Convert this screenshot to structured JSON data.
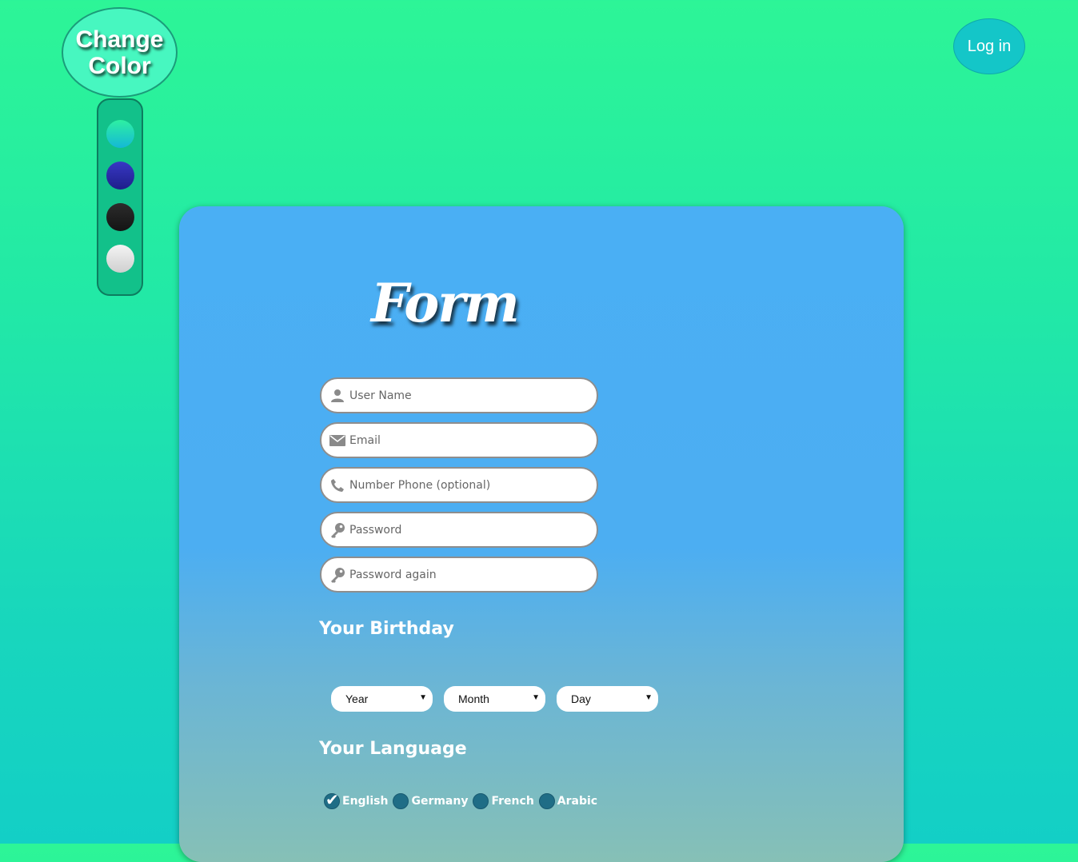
{
  "theme_picker": {
    "button_label": "Change\nColor",
    "swatches": [
      {
        "name": "green-cyan",
        "color": "#2ef0a2"
      },
      {
        "name": "blue",
        "color": "#2a2ab0"
      },
      {
        "name": "black",
        "color": "#1e1e1e"
      },
      {
        "name": "white",
        "color": "#e8e8e8"
      }
    ]
  },
  "header": {
    "login_label": "Log in"
  },
  "form": {
    "title": "Form",
    "fields": [
      {
        "placeholder": "User Name",
        "icon": "user-icon"
      },
      {
        "placeholder": "Email",
        "icon": "envelope-icon"
      },
      {
        "placeholder": "Number Phone (optional)",
        "icon": "phone-icon"
      },
      {
        "placeholder": "Password",
        "icon": "key-icon"
      },
      {
        "placeholder": "Password again",
        "icon": "key-icon"
      }
    ],
    "birthday": {
      "label": "Your Birthday",
      "year": "Year",
      "month": "Month",
      "day": "Day"
    },
    "language": {
      "label": "Your Language",
      "options": [
        {
          "label": "English",
          "checked": true
        },
        {
          "label": "Germany",
          "checked": false
        },
        {
          "label": "French",
          "checked": false
        },
        {
          "label": "Arabic",
          "checked": false
        }
      ]
    }
  },
  "colors": {
    "background_top": "#2df597",
    "background_bottom": "#13cfc6",
    "card_top": "#4aaff4",
    "card_bottom": "#86c0b6",
    "login_button": "#14c6c8"
  }
}
